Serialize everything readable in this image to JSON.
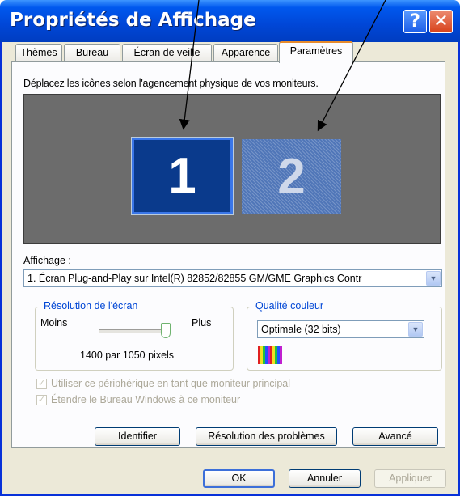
{
  "window": {
    "title": "Propriétés de Affichage",
    "help_glyph": "?",
    "close_glyph": "✕"
  },
  "tabs": [
    {
      "label": "Thèmes"
    },
    {
      "label": "Bureau"
    },
    {
      "label": "Écran de veille"
    },
    {
      "label": "Apparence"
    },
    {
      "label": "Paramètres",
      "active": true
    }
  ],
  "settings": {
    "instruction": "Déplacez les icônes selon l'agencement physique de vos moniteurs.",
    "monitors": [
      {
        "number": "1",
        "selected": true
      },
      {
        "number": "2",
        "selected": false
      }
    ],
    "display_label": "Affichage :",
    "display_value": "1. Écran Plug-and-Play sur Intel(R) 82852/82855 GM/GME Graphics Contr",
    "resolution": {
      "title": "Résolution de l'écran",
      "min_label": "Moins",
      "max_label": "Plus",
      "value_text": "1400 par 1050 pixels",
      "slider_level": 1.0
    },
    "color_quality": {
      "title": "Qualité couleur",
      "value": "Optimale (32 bits)"
    },
    "checkbox_primary": {
      "label": "Utiliser ce périphérique en tant que moniteur principal",
      "checked": true,
      "enabled": false
    },
    "checkbox_extend": {
      "label": "Étendre le Bureau Windows à ce moniteur",
      "checked": true,
      "enabled": false
    },
    "buttons": {
      "identify": "Identifier",
      "troubleshoot": "Résolution des problèmes",
      "advanced": "Avancé"
    }
  },
  "footer": {
    "ok": "OK",
    "cancel": "Annuler",
    "apply": "Appliquer"
  },
  "colors": {
    "title_bar": "#0054e3",
    "monitor_area": "#6c6c6c",
    "monitor_selected": "#0a3a8c",
    "group_title": "#0046d5"
  },
  "check_glyph": "✓",
  "dropdown_glyph": "▼"
}
